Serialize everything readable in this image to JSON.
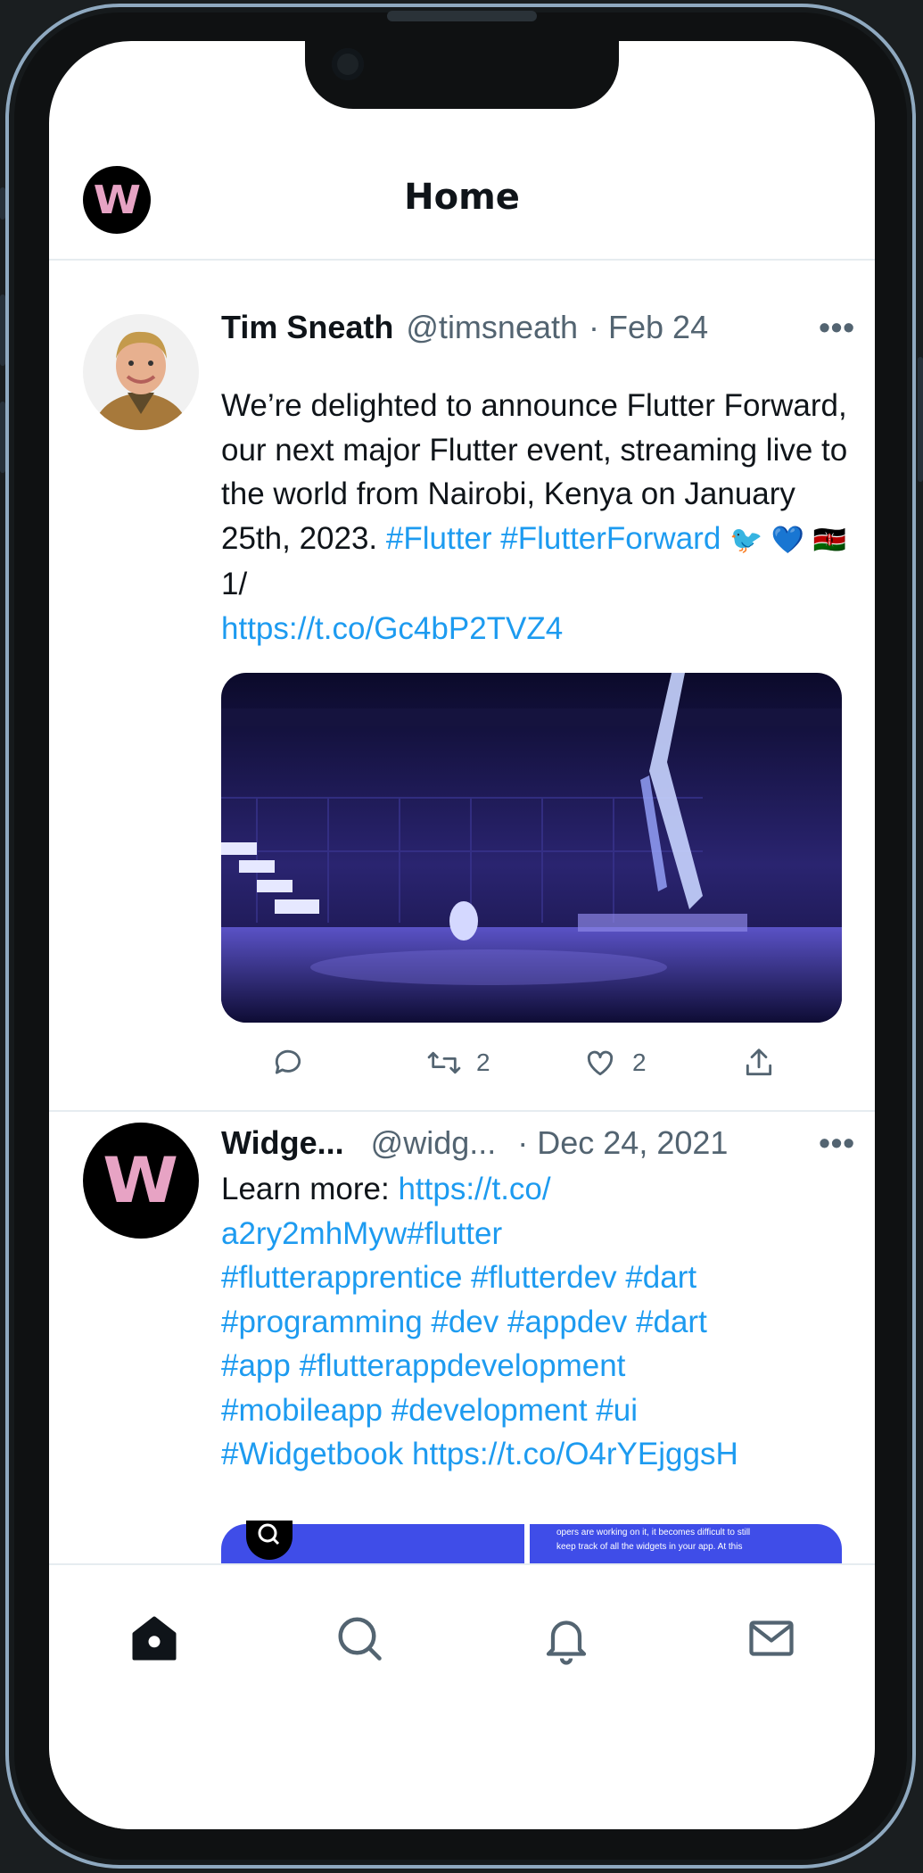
{
  "header": {
    "title": "Home",
    "logo_text": "W"
  },
  "tweets": [
    {
      "name": "Tim Sneath",
      "handle": "@timsneath",
      "separator": "·",
      "date": "Feb 24",
      "more": "•••",
      "text_plain": "We’re delighted to announce Flutter Forward, our next major Flutter event, streaming live to the world from Nairobi, Kenya on January 25th, 2023.",
      "hashtags": "#Flutter #FlutterForward",
      "emojis": "🐦 💙 🇰🇪",
      "thread_marker": "1/",
      "link": "https://t.co/Gc4bP2TVZ4",
      "actions": {
        "reply_count": "",
        "retweet_count": "2",
        "like_count": "2"
      }
    },
    {
      "name": "Widge...",
      "handle": "@widg...",
      "separator": "·",
      "date": "Dec 24, 2021",
      "more": "•••",
      "text_prefix": "Learn more: ",
      "link_lines": [
        "https://t.co/",
        "a2ry2mhMyw#flutter",
        "#flutterapprentice #flutterdev #dart",
        "#programming #dev #appdev #dart",
        "#app #flutterappdevelopment",
        "#mobileapp #development #ui",
        "#Widgetbook https://t.co/O4rYEjggsH"
      ],
      "media_text": [
        "opers are working on it, it becomes difficult to still",
        "keep track of all the widgets in your app. At this"
      ]
    }
  ],
  "bottom_nav": [
    "home-icon",
    "search-icon",
    "bell-icon",
    "mail-icon"
  ],
  "colors": {
    "link": "#1d9bf0",
    "muted": "#536471",
    "text": "#0f1419",
    "frame": "#8fa9c0"
  }
}
